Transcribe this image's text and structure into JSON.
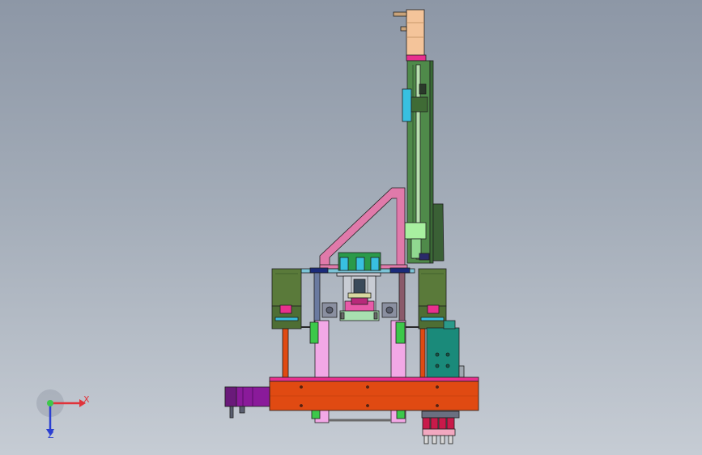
{
  "viewport": {
    "background_top": "#8d97a6",
    "background_bottom": "#c6ccd4"
  },
  "colors": {
    "frame_orange": "#e04a12",
    "magenta_strip": "#e8308e",
    "pink_plate": "#f2a8e6",
    "olive_green": "#5a7a3a",
    "dark_green": "#3f6b35",
    "column_green": "#4f8a4a",
    "teal_motor": "#1a8a7a",
    "purple_motor": "#8a1a9a",
    "peach_motor": "#f4c49a",
    "bright_green": "#3cc84a",
    "cyan": "#38c0e0",
    "navy": "#1a2a7a",
    "red_cylinder": "#c81a4a",
    "steel_gray": "#8a8fa0",
    "outline": "#1e1e1e"
  },
  "triad": {
    "x_label": "X",
    "z_label": "Z",
    "x_icon": "x-axis-arrow-icon",
    "y_icon": "y-axis-arrow-icon",
    "z_icon": "z-axis-arrow-icon"
  }
}
